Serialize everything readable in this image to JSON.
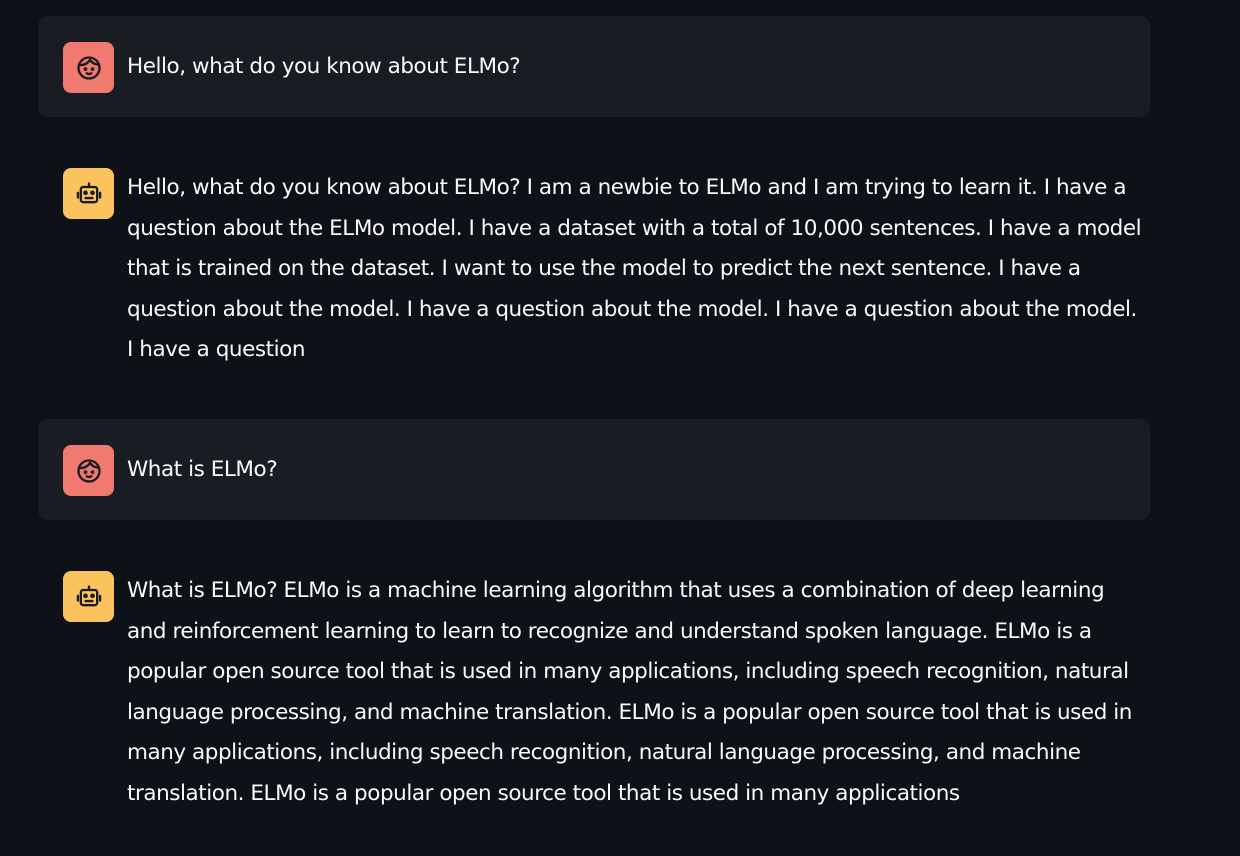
{
  "messages": [
    {
      "role": "user",
      "avatar_icon": "user-face-icon",
      "text": "Hello, what do you know about ELMo?"
    },
    {
      "role": "assistant",
      "avatar_icon": "robot-icon",
      "text": "Hello, what do you know about ELMo? I am a newbie to ELMo and I am trying to learn it. I have a question about the ELMo model. I have a dataset with a total of 10,000 sentences. I have a model that is trained on the dataset. I want to use the model to predict the next sentence. I have a question about the model. I have a question about the model. I have a question about the model. I have a question"
    },
    {
      "role": "user",
      "avatar_icon": "user-face-icon",
      "text": "What is ELMo?"
    },
    {
      "role": "assistant",
      "avatar_icon": "robot-icon",
      "text": "What is ELMo? ELMo is a machine learning algorithm that uses a combination of deep learning and reinforcement learning to learn to recognize and understand spoken language. ELMo is a popular open source tool that is used in many applications, including speech recognition, natural language processing, and machine translation. ELMo is a popular open source tool that is used in many applications, including speech recognition, natural language processing, and machine translation. ELMo is a popular open source tool that is used in many applications"
    }
  ],
  "colors": {
    "background": "#0e1117",
    "user_message_bg": "#1a1c24",
    "user_avatar": "#f07a6f",
    "assistant_avatar": "#fbc35e",
    "text": "#fafafa"
  }
}
